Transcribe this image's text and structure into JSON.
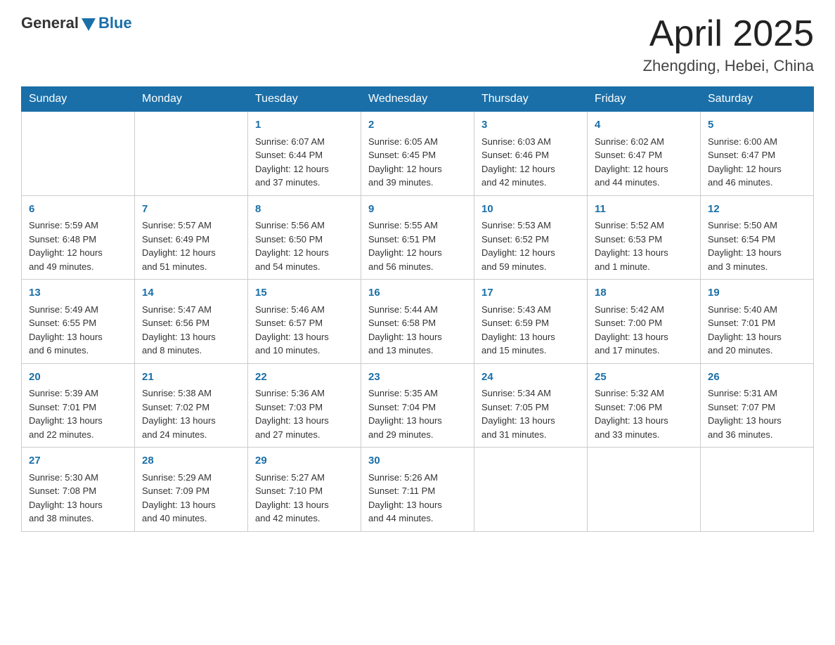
{
  "header": {
    "logo_general": "General",
    "logo_blue": "Blue",
    "month_year": "April 2025",
    "location": "Zhengding, Hebei, China"
  },
  "days_of_week": [
    "Sunday",
    "Monday",
    "Tuesday",
    "Wednesday",
    "Thursday",
    "Friday",
    "Saturday"
  ],
  "weeks": [
    [
      {
        "day": "",
        "info": ""
      },
      {
        "day": "",
        "info": ""
      },
      {
        "day": "1",
        "info": "Sunrise: 6:07 AM\nSunset: 6:44 PM\nDaylight: 12 hours\nand 37 minutes."
      },
      {
        "day": "2",
        "info": "Sunrise: 6:05 AM\nSunset: 6:45 PM\nDaylight: 12 hours\nand 39 minutes."
      },
      {
        "day": "3",
        "info": "Sunrise: 6:03 AM\nSunset: 6:46 PM\nDaylight: 12 hours\nand 42 minutes."
      },
      {
        "day": "4",
        "info": "Sunrise: 6:02 AM\nSunset: 6:47 PM\nDaylight: 12 hours\nand 44 minutes."
      },
      {
        "day": "5",
        "info": "Sunrise: 6:00 AM\nSunset: 6:47 PM\nDaylight: 12 hours\nand 46 minutes."
      }
    ],
    [
      {
        "day": "6",
        "info": "Sunrise: 5:59 AM\nSunset: 6:48 PM\nDaylight: 12 hours\nand 49 minutes."
      },
      {
        "day": "7",
        "info": "Sunrise: 5:57 AM\nSunset: 6:49 PM\nDaylight: 12 hours\nand 51 minutes."
      },
      {
        "day": "8",
        "info": "Sunrise: 5:56 AM\nSunset: 6:50 PM\nDaylight: 12 hours\nand 54 minutes."
      },
      {
        "day": "9",
        "info": "Sunrise: 5:55 AM\nSunset: 6:51 PM\nDaylight: 12 hours\nand 56 minutes."
      },
      {
        "day": "10",
        "info": "Sunrise: 5:53 AM\nSunset: 6:52 PM\nDaylight: 12 hours\nand 59 minutes."
      },
      {
        "day": "11",
        "info": "Sunrise: 5:52 AM\nSunset: 6:53 PM\nDaylight: 13 hours\nand 1 minute."
      },
      {
        "day": "12",
        "info": "Sunrise: 5:50 AM\nSunset: 6:54 PM\nDaylight: 13 hours\nand 3 minutes."
      }
    ],
    [
      {
        "day": "13",
        "info": "Sunrise: 5:49 AM\nSunset: 6:55 PM\nDaylight: 13 hours\nand 6 minutes."
      },
      {
        "day": "14",
        "info": "Sunrise: 5:47 AM\nSunset: 6:56 PM\nDaylight: 13 hours\nand 8 minutes."
      },
      {
        "day": "15",
        "info": "Sunrise: 5:46 AM\nSunset: 6:57 PM\nDaylight: 13 hours\nand 10 minutes."
      },
      {
        "day": "16",
        "info": "Sunrise: 5:44 AM\nSunset: 6:58 PM\nDaylight: 13 hours\nand 13 minutes."
      },
      {
        "day": "17",
        "info": "Sunrise: 5:43 AM\nSunset: 6:59 PM\nDaylight: 13 hours\nand 15 minutes."
      },
      {
        "day": "18",
        "info": "Sunrise: 5:42 AM\nSunset: 7:00 PM\nDaylight: 13 hours\nand 17 minutes."
      },
      {
        "day": "19",
        "info": "Sunrise: 5:40 AM\nSunset: 7:01 PM\nDaylight: 13 hours\nand 20 minutes."
      }
    ],
    [
      {
        "day": "20",
        "info": "Sunrise: 5:39 AM\nSunset: 7:01 PM\nDaylight: 13 hours\nand 22 minutes."
      },
      {
        "day": "21",
        "info": "Sunrise: 5:38 AM\nSunset: 7:02 PM\nDaylight: 13 hours\nand 24 minutes."
      },
      {
        "day": "22",
        "info": "Sunrise: 5:36 AM\nSunset: 7:03 PM\nDaylight: 13 hours\nand 27 minutes."
      },
      {
        "day": "23",
        "info": "Sunrise: 5:35 AM\nSunset: 7:04 PM\nDaylight: 13 hours\nand 29 minutes."
      },
      {
        "day": "24",
        "info": "Sunrise: 5:34 AM\nSunset: 7:05 PM\nDaylight: 13 hours\nand 31 minutes."
      },
      {
        "day": "25",
        "info": "Sunrise: 5:32 AM\nSunset: 7:06 PM\nDaylight: 13 hours\nand 33 minutes."
      },
      {
        "day": "26",
        "info": "Sunrise: 5:31 AM\nSunset: 7:07 PM\nDaylight: 13 hours\nand 36 minutes."
      }
    ],
    [
      {
        "day": "27",
        "info": "Sunrise: 5:30 AM\nSunset: 7:08 PM\nDaylight: 13 hours\nand 38 minutes."
      },
      {
        "day": "28",
        "info": "Sunrise: 5:29 AM\nSunset: 7:09 PM\nDaylight: 13 hours\nand 40 minutes."
      },
      {
        "day": "29",
        "info": "Sunrise: 5:27 AM\nSunset: 7:10 PM\nDaylight: 13 hours\nand 42 minutes."
      },
      {
        "day": "30",
        "info": "Sunrise: 5:26 AM\nSunset: 7:11 PM\nDaylight: 13 hours\nand 44 minutes."
      },
      {
        "day": "",
        "info": ""
      },
      {
        "day": "",
        "info": ""
      },
      {
        "day": "",
        "info": ""
      }
    ]
  ]
}
